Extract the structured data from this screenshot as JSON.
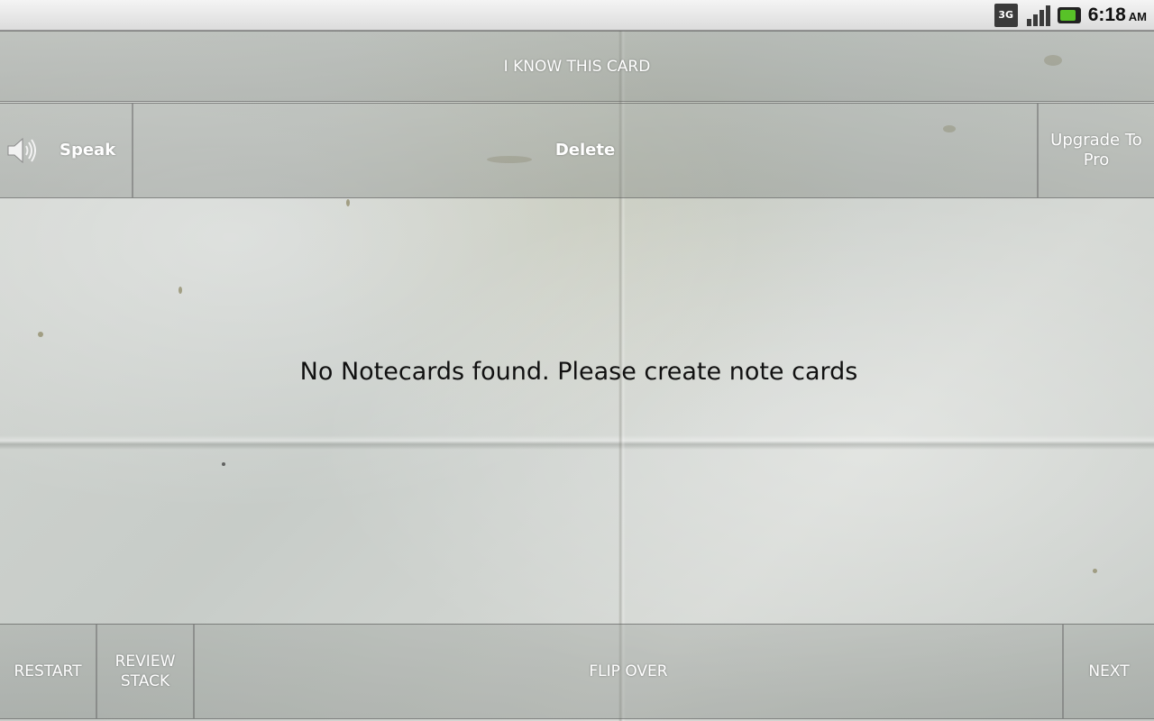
{
  "status_bar": {
    "network": "3G",
    "time": "6:18",
    "ampm": "AM",
    "icons": [
      "3g-icon",
      "signal-icon",
      "battery-icon"
    ]
  },
  "top": {
    "know_label": "I KNOW THIS CARD"
  },
  "actions": {
    "speak_label": "Speak",
    "delete_label": "Delete",
    "upgrade_label": "Upgrade To Pro"
  },
  "main": {
    "message": "No Notecards found. Please create note cards"
  },
  "bottom": {
    "restart_label": "RESTART",
    "review_label": "REVIEW STACK",
    "flip_label": "FLIP OVER",
    "next_label": "NEXT"
  },
  "colors": {
    "button_text": "#ffffff",
    "message_text": "#111111",
    "battery": "#58c228"
  }
}
